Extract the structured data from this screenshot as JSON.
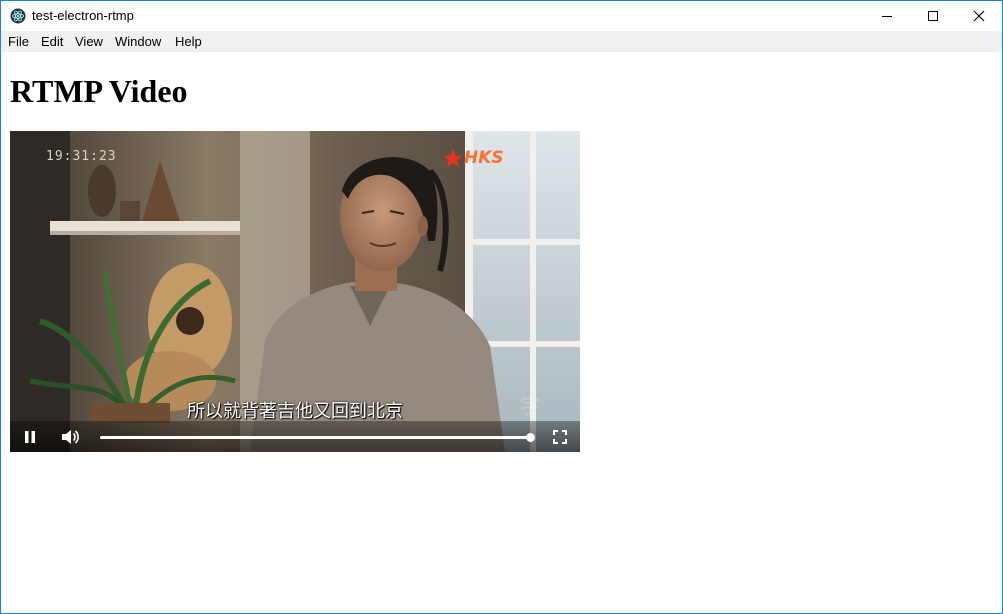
{
  "window": {
    "title": "test-electron-rtmp",
    "app_icon": "electron-atom-icon",
    "controls": [
      "minimize-icon",
      "maximize-icon",
      "close-icon"
    ],
    "border_color": "#1883d7"
  },
  "menu": {
    "items": [
      "File",
      "Edit",
      "View",
      "Window",
      "Help"
    ]
  },
  "page": {
    "heading": "RTMP Video"
  },
  "video": {
    "timecode": "19:31:23",
    "channel_logo": "HKS",
    "subtitle": "所以就背著吉他又回到北京",
    "state": "playing",
    "progress": 1.0,
    "icons": {
      "play": "pause-icon",
      "volume": "volume-icon",
      "fullscreen": "fullscreen-icon"
    }
  }
}
